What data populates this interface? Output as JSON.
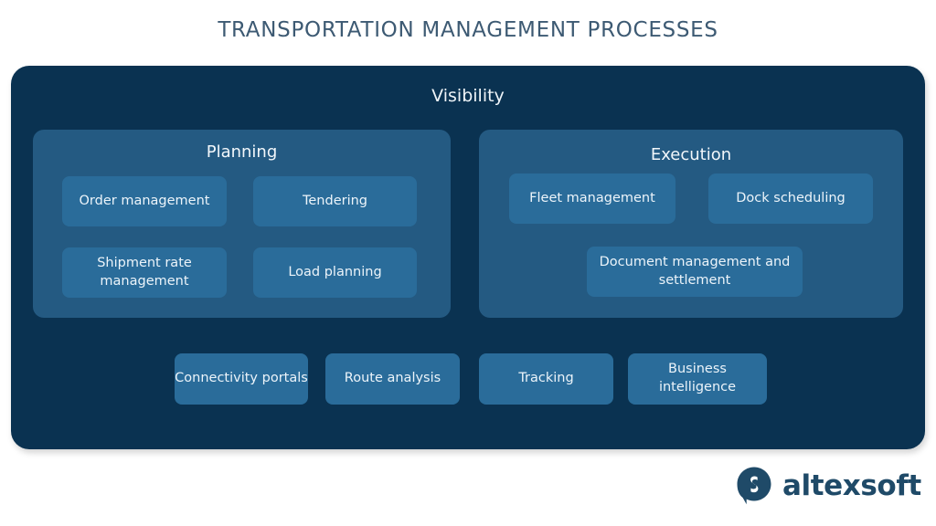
{
  "title": "TRANSPORTATION MANAGEMENT PROCESSES",
  "panel": {
    "title": "Visibility",
    "groups": [
      {
        "title": "Planning",
        "cards": [
          {
            "label": "Order management"
          },
          {
            "label": "Tendering"
          },
          {
            "label": "Shipment rate management"
          },
          {
            "label": "Load planning"
          }
        ]
      },
      {
        "title": "Execution",
        "cards": [
          {
            "label": "Fleet management"
          },
          {
            "label": "Dock scheduling"
          },
          {
            "label": "Document management and settlement"
          }
        ]
      }
    ],
    "bottom_cards": [
      {
        "label": "Connectivity portals"
      },
      {
        "label": "Route analysis"
      },
      {
        "label": "Tracking"
      },
      {
        "label": "Business intelligence"
      }
    ]
  },
  "logo": {
    "text": "altexsoft",
    "mark": "speech-bubble-s-icon"
  },
  "colors": {
    "background": "#ffffff",
    "title_text": "#3d5a73",
    "panel_bg": "#0a3251",
    "group_bg": "#245a82",
    "card_bg": "#2a6c9a",
    "card_text": "#ecf4fa",
    "logo_navy": "#1f4a68"
  }
}
